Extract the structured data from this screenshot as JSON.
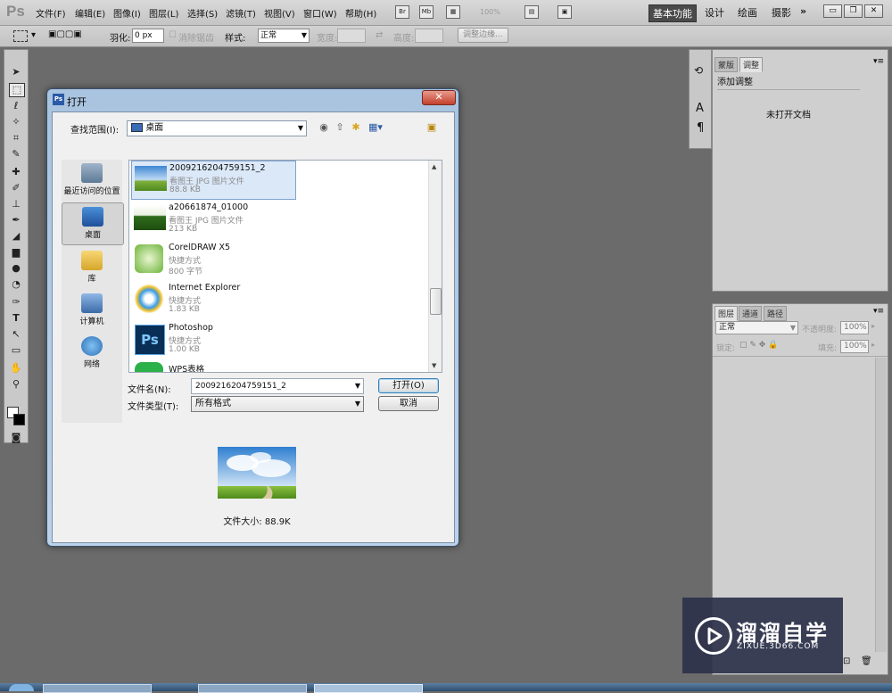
{
  "app": {
    "logo": "Ps",
    "menus": [
      "文件(F)",
      "编辑(E)",
      "图像(I)",
      "图层(L)",
      "选择(S)",
      "滤镜(T)",
      "视图(V)",
      "窗口(W)",
      "帮助(H)"
    ],
    "zoom": "100%",
    "workspaces": [
      "基本功能",
      "设计",
      "绘画",
      "摄影"
    ],
    "more": "»"
  },
  "options": {
    "feather_label": "羽化:",
    "feather_value": "0 px",
    "antialias_label": "消除锯齿",
    "style_label": "样式:",
    "style_value": "正常",
    "width_label": "宽度:",
    "height_label": "高度:",
    "refine_button": "调整边缘..."
  },
  "adjust_panel": {
    "tabs": [
      "蒙版",
      "调整"
    ],
    "heading": "添加调整",
    "message": "未打开文档"
  },
  "layers_panel": {
    "tabs": [
      "图层",
      "通道",
      "路径"
    ],
    "blend_mode": "正常",
    "opacity_label": "不透明度:",
    "opacity_value": "100%",
    "lock_label": "锁定:",
    "fill_label": "填充:",
    "fill_value": "100%"
  },
  "dialog": {
    "title": "打开",
    "lookin_label": "查找范围(I):",
    "lookin_value": "桌面",
    "places": [
      "最近访问的位置",
      "桌面",
      "库",
      "计算机",
      "网络"
    ],
    "files": [
      {
        "name": "2009216204759151_2",
        "type": "看图王 JPG 图片文件",
        "size": "88.8 KB"
      },
      {
        "name": "a20661874_01000",
        "type": "看图王 JPG 图片文件",
        "size": "213 KB"
      },
      {
        "name": "CorelDRAW X5",
        "type": "快捷方式",
        "size": "800 字节"
      },
      {
        "name": "Internet Explorer",
        "type": "快捷方式",
        "size": "1.83 KB"
      },
      {
        "name": "Photoshop",
        "type": "快捷方式",
        "size": "1.00 KB"
      },
      {
        "name": "WPS表格",
        "type": "",
        "size": ""
      }
    ],
    "filename_label": "文件名(N):",
    "filename_value": "2009216204759151_2",
    "filetype_label": "文件类型(T):",
    "filetype_value": "所有格式",
    "open_button": "打开(O)",
    "cancel_button": "取消",
    "filesize_text": "文件大小: 88.9K"
  },
  "watermark": {
    "title": "溜溜自学",
    "subtitle": "ZIXUE.3D66.COM"
  }
}
